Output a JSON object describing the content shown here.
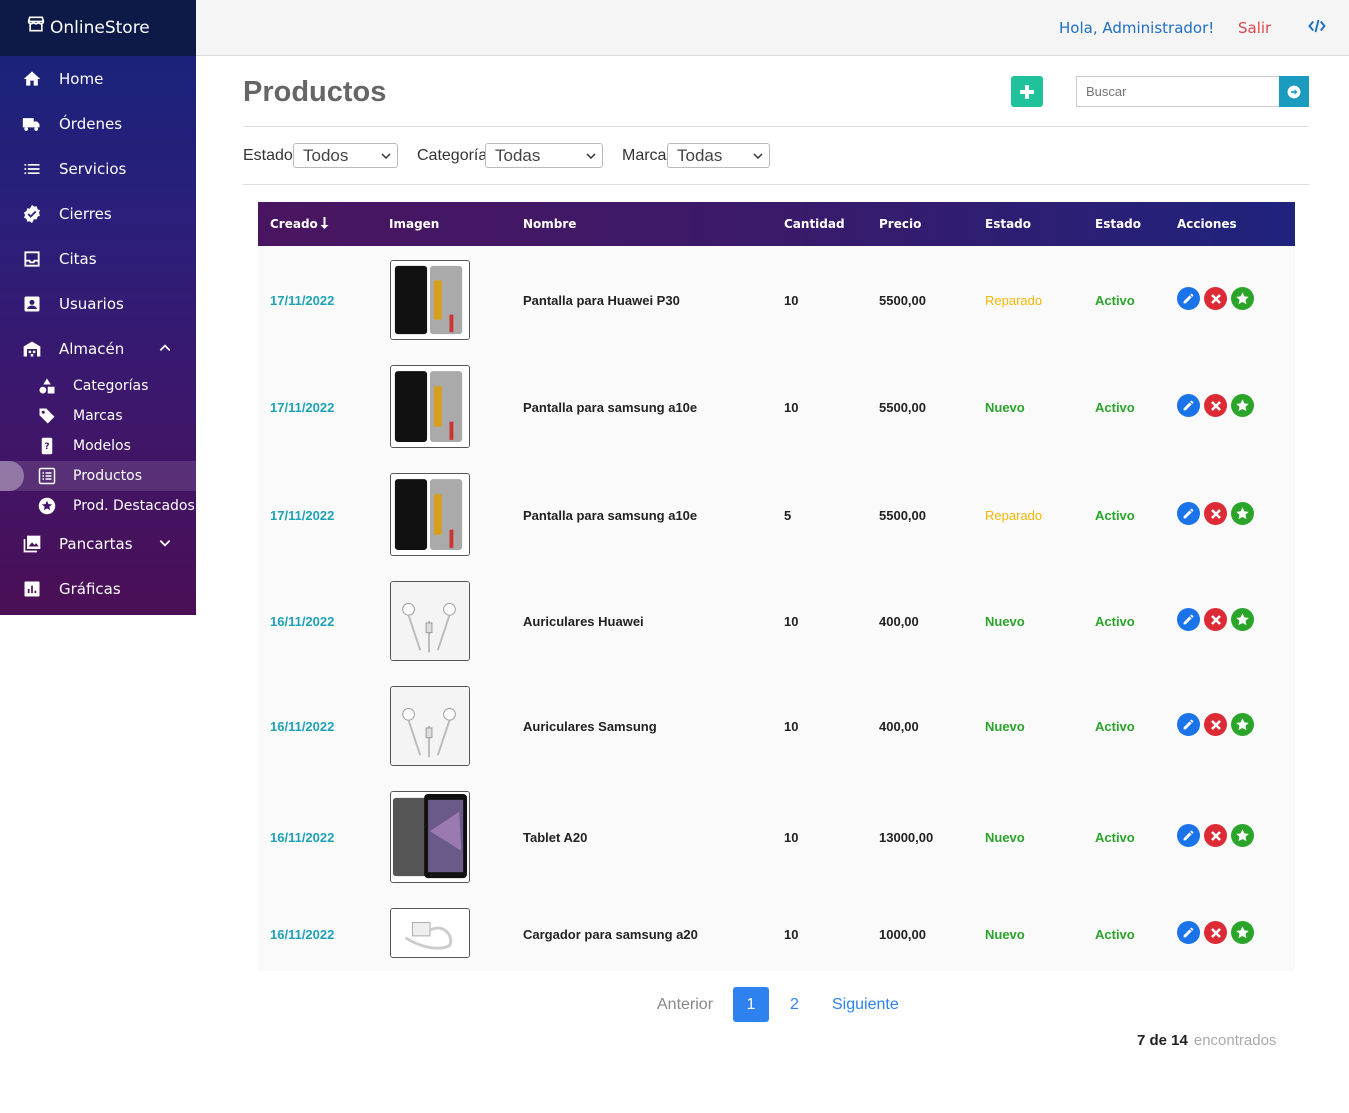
{
  "brand": {
    "name": "OnlineStore",
    "icon": "store-icon"
  },
  "sidebar": {
    "items": [
      {
        "label": "Home",
        "icon": "home-icon"
      },
      {
        "label": "Órdenes",
        "icon": "truck-icon"
      },
      {
        "label": "Servicios",
        "icon": "list-icon"
      },
      {
        "label": "Cierres",
        "icon": "badge-check-icon"
      },
      {
        "label": "Citas",
        "icon": "inbox-icon"
      },
      {
        "label": "Usuarios",
        "icon": "user-card-icon"
      },
      {
        "label": "Almacén",
        "icon": "warehouse-icon",
        "expanded": true
      },
      {
        "label": "Pancartas",
        "icon": "image-icon",
        "expanded": false
      },
      {
        "label": "Gráficas",
        "icon": "chart-icon"
      }
    ],
    "subitems": [
      {
        "label": "Categorías",
        "icon": "shapes-icon"
      },
      {
        "label": "Marcas",
        "icon": "tag-icon"
      },
      {
        "label": "Modelos",
        "icon": "phone-question-icon"
      },
      {
        "label": "Productos",
        "icon": "list-box-icon",
        "active": true
      },
      {
        "label": "Prod. Destacados",
        "icon": "star-circle-icon"
      }
    ]
  },
  "topbar": {
    "greeting": "Hola, Administrador!",
    "logout": "Salir",
    "code_icon": "code-icon"
  },
  "page": {
    "title": "Productos"
  },
  "search": {
    "placeholder": "Buscar"
  },
  "filters": {
    "estado": {
      "label": "Estado",
      "value": "Todos"
    },
    "categoria": {
      "label": "Categoría",
      "value": "Todas"
    },
    "marca": {
      "label": "Marca",
      "value": "Todas"
    }
  },
  "table": {
    "headers": [
      "Creado",
      "Imagen",
      "Nombre",
      "Cantidad",
      "Precio",
      "Estado",
      "Estado",
      "Acciones"
    ],
    "rows": [
      {
        "date": "17/11/2022",
        "image": "lcd-screen",
        "name": "Pantalla para Huawei P30",
        "qty": "10",
        "price": "5500,00",
        "condition": "Reparado",
        "status": "Activo"
      },
      {
        "date": "17/11/2022",
        "image": "lcd-screen",
        "name": "Pantalla para samsung a10e",
        "qty": "10",
        "price": "5500,00",
        "condition": "Nuevo",
        "status": "Activo"
      },
      {
        "date": "17/11/2022",
        "image": "lcd-screen",
        "name": "Pantalla para samsung a10e",
        "qty": "5",
        "price": "5500,00",
        "condition": "Reparado",
        "status": "Activo"
      },
      {
        "date": "16/11/2022",
        "image": "earphones",
        "name": "Auriculares Huawei",
        "qty": "10",
        "price": "400,00",
        "condition": "Nuevo",
        "status": "Activo"
      },
      {
        "date": "16/11/2022",
        "image": "earphones",
        "name": "Auriculares Samsung",
        "qty": "10",
        "price": "400,00",
        "condition": "Nuevo",
        "status": "Activo"
      },
      {
        "date": "16/11/2022",
        "image": "tablet",
        "name": "Tablet A20",
        "qty": "10",
        "price": "13000,00",
        "condition": "Nuevo",
        "status": "Activo"
      },
      {
        "date": "16/11/2022",
        "image": "charger",
        "name": "Cargador para samsung a20",
        "qty": "10",
        "price": "1000,00",
        "condition": "Nuevo",
        "status": "Activo"
      }
    ]
  },
  "pagination": {
    "prev": "Anterior",
    "pages": [
      "1",
      "2"
    ],
    "current": "1",
    "next": "Siguiente"
  },
  "results": {
    "count": "7 de 14",
    "suffix": "encontrados"
  },
  "colors": {
    "accent": "#1fc29b",
    "primary": "#2d82f0",
    "danger": "#dd2b36",
    "success": "#2aa52a",
    "warning": "#f2b705",
    "link": "#1ea3b5"
  }
}
